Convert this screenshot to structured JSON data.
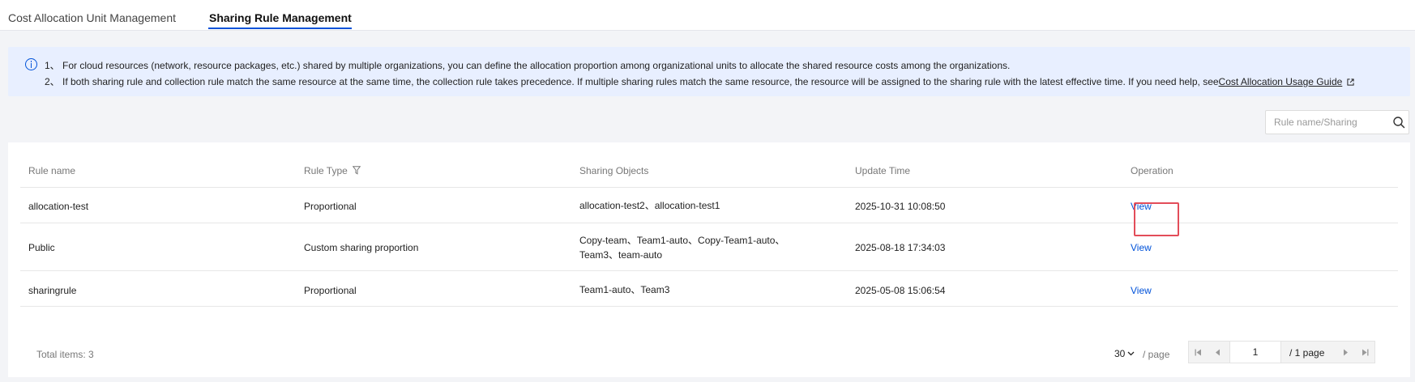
{
  "tabs": [
    {
      "label": "Cost Allocation Unit Management",
      "active": false
    },
    {
      "label": "Sharing Rule Management",
      "active": true
    }
  ],
  "notice": {
    "line1": "1、 For cloud resources (network, resource packages, etc.) shared by multiple organizations, you can define the allocation proportion among organizational units to allocate the shared resource costs among the organizations.",
    "line2": "2、 If both sharing rule and collection rule match the same resource at the same time, the collection rule takes precedence. If multiple sharing rules match the same resource, the resource will be assigned to the sharing rule with the latest effective time. If you need help, see",
    "link_label": "Cost Allocation Usage Guide"
  },
  "search": {
    "placeholder": "Rule name/Sharing",
    "value": ""
  },
  "table": {
    "headers": {
      "rule_name": "Rule name",
      "rule_type": "Rule Type",
      "sharing_objects": "Sharing Objects",
      "update_time": "Update Time",
      "operation": "Operation"
    },
    "rows": [
      {
        "rule_name": "allocation-test",
        "rule_type": "Proportional",
        "sharing_objects": "allocation-test2、allocation-test1",
        "update_time": "2025-10-31 10:08:50",
        "operation": "View"
      },
      {
        "rule_name": "Public",
        "rule_type": "Custom sharing proportion",
        "sharing_objects": "Copy-team、Team1-auto、Copy-Team1-auto、Team3、team-auto",
        "update_time": "2025-08-18 17:34:03",
        "operation": "View"
      },
      {
        "rule_name": "sharingrule",
        "rule_type": "Proportional",
        "sharing_objects": "Team1-auto、Team3",
        "update_time": "2025-05-08 15:06:54",
        "operation": "View"
      }
    ]
  },
  "footer": {
    "total": "Total items: 3",
    "page_size": "30",
    "per_page": "/ page",
    "current_page": "1",
    "page_of": "/ 1 page"
  },
  "icons": {
    "info": "info-circle-icon",
    "external": "external-link-icon",
    "search": "search-icon",
    "filter": "filter-icon",
    "page_size": "chevron-down-icon",
    "first": "first-page-icon",
    "prev": "prev-page-icon",
    "next": "next-page-icon",
    "last": "last-page-icon"
  },
  "colors": {
    "accent": "#0052d9",
    "highlight": "#e34d59",
    "notice_bg": "#e8efff"
  }
}
